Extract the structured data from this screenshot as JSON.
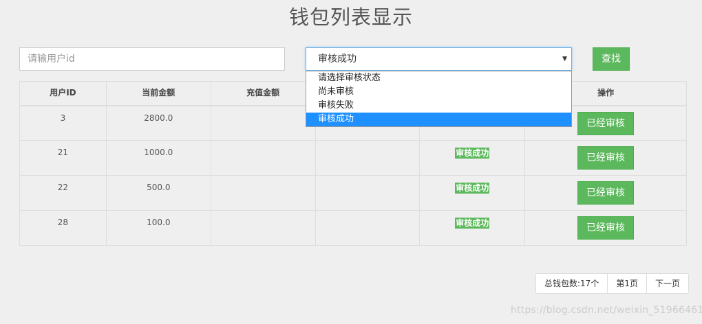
{
  "page": {
    "title": "钱包列表显示"
  },
  "search": {
    "placeholder": "请输用户id",
    "value": ""
  },
  "status_select": {
    "selected": "审核成功",
    "options": [
      "请选择审核状态",
      "尚未审核",
      "审核失败",
      "审核成功"
    ]
  },
  "find_button": {
    "label": "查找"
  },
  "table": {
    "headers": [
      "用户ID",
      "当前金额",
      "充值金额",
      "",
      "",
      "操作"
    ],
    "rows": [
      {
        "user_id": "3",
        "balance": "2800.0",
        "recharge": "",
        "col4": "",
        "status": "",
        "action": "已经审核"
      },
      {
        "user_id": "21",
        "balance": "1000.0",
        "recharge": "",
        "col4": "",
        "status": "审核成功",
        "action": "已经审核"
      },
      {
        "user_id": "22",
        "balance": "500.0",
        "recharge": "",
        "col4": "",
        "status": "审核成功",
        "action": "已经审核"
      },
      {
        "user_id": "28",
        "balance": "100.0",
        "recharge": "",
        "col4": "",
        "status": "审核成功",
        "action": "已经审核"
      }
    ]
  },
  "pagination": {
    "total": "总钱包数:17个",
    "current_page": "第1页",
    "next": "下一页"
  },
  "watermark": "https://blog.csdn.net/weixin_51966461",
  "colors": {
    "accent_green": "#5cb85c",
    "selected_option": "#1e90ff",
    "focus_border": "#66afe9"
  }
}
